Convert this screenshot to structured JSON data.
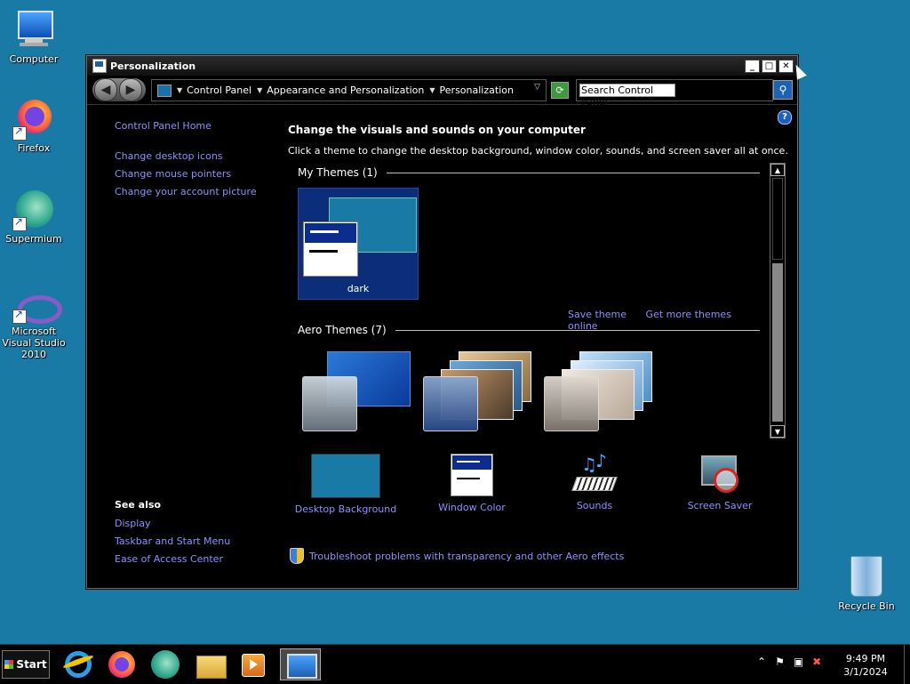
{
  "desktop": {
    "icons": [
      {
        "label": "Computer"
      },
      {
        "label": "Firefox"
      },
      {
        "label": "Supermium"
      },
      {
        "label": "Microsoft Visual Studio 2010"
      },
      {
        "label": "Recycle Bin"
      }
    ]
  },
  "window": {
    "title": "Personalization",
    "controls": {
      "minimize": "_",
      "maximize": "□",
      "close": "✕"
    },
    "address": {
      "crumbs": [
        "Control Panel",
        "Appearance and Personalization",
        "Personalization"
      ]
    },
    "search": {
      "value": "Search Control Panel"
    },
    "help": "?"
  },
  "sidebar": {
    "links": [
      "Control Panel Home",
      "Change desktop icons",
      "Change mouse pointers",
      "Change your account picture"
    ],
    "see_also": {
      "header": "See also",
      "links": [
        "Display",
        "Taskbar and Start Menu",
        "Ease of Access Center"
      ]
    }
  },
  "main": {
    "title": "Change the visuals and sounds on your computer",
    "description": "Click a theme to change the desktop background, window color, sounds, and screen saver all at once.",
    "my_themes": {
      "header": "My Themes (1)",
      "items": [
        {
          "name": "dark"
        }
      ]
    },
    "save_theme": "Save theme",
    "get_more": "Get more themes online",
    "aero_themes": {
      "header": "Aero Themes (7)"
    },
    "bottom": [
      {
        "label": "Desktop Background",
        "icon": "desktop-background-icon"
      },
      {
        "label": "Window Color",
        "icon": "window-color-icon"
      },
      {
        "label": "Sounds",
        "icon": "sounds-icon"
      },
      {
        "label": "Screen Saver",
        "icon": "screen-saver-icon"
      }
    ],
    "troubleshoot": "Troubleshoot problems with transparency and other Aero effects"
  },
  "taskbar": {
    "start": "Start",
    "clock": {
      "time": "9:49 PM",
      "date": "3/1/2024"
    }
  },
  "colors": {
    "desktop": "#1a7aa6",
    "link": "#8f8fff",
    "window": "#000000"
  }
}
